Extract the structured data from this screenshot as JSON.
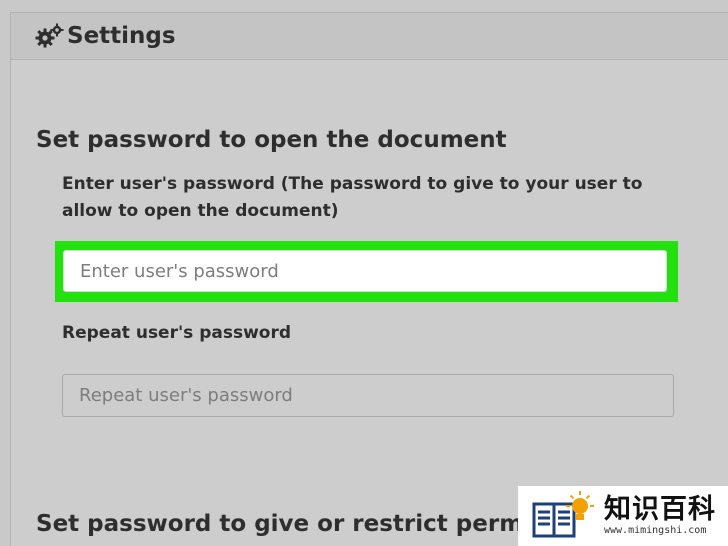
{
  "panel": {
    "title": "Settings",
    "icon": "gears-icon"
  },
  "open_section": {
    "heading": "Set password to open the document",
    "user_password_label": "Enter user's password (The password to give to your user to allow to open the document)",
    "user_password_placeholder": "Enter user's password",
    "user_password_value": "",
    "repeat_label": "Repeat user's password",
    "repeat_placeholder": "Repeat user's password",
    "repeat_value": ""
  },
  "permissions_section": {
    "heading": "Set password to give or restrict permissio"
  },
  "highlight": {
    "color": "#22e10e",
    "target": "user-password-input"
  },
  "watermark": {
    "title": "知识百科",
    "url": "www.mimingshi.com",
    "icon": "book-lightbulb-icon"
  }
}
